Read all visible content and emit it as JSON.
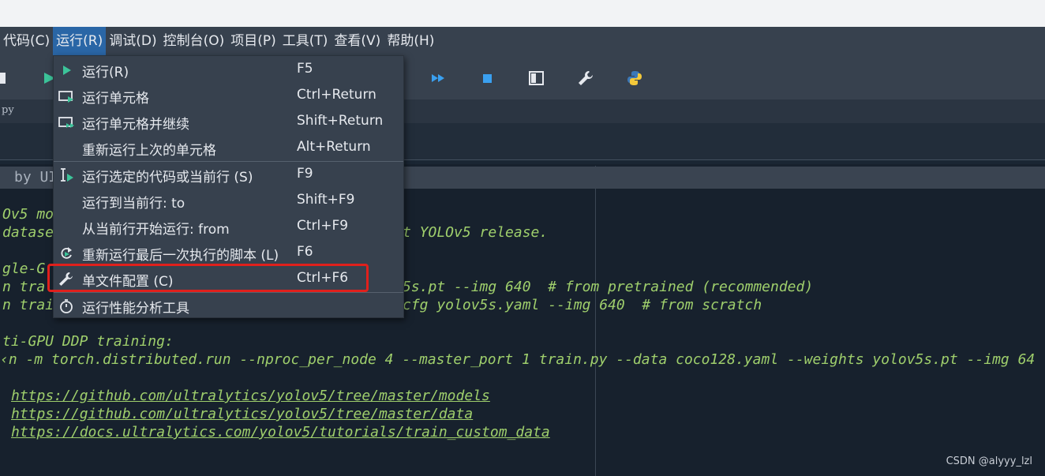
{
  "menubar": {
    "items": [
      "代码(C)",
      "运行(R)",
      "调试(D)",
      "控制台(O)",
      "项目(P)",
      "工具(T)",
      "查看(V)",
      "帮助(H)"
    ],
    "active_index": 1
  },
  "tab": {
    "text": "py"
  },
  "editor_header": "by UI",
  "run_menu": {
    "items": [
      {
        "label": "运行(R)",
        "shortcut": "F5",
        "icon": "play-icon"
      },
      {
        "label": "运行单元格",
        "shortcut": "Ctrl+Return",
        "icon": "run-cell-icon"
      },
      {
        "label": "运行单元格并继续",
        "shortcut": "Shift+Return",
        "icon": "run-cell-advance-icon"
      },
      {
        "label": "重新运行上次的单元格",
        "shortcut": "Alt+Return",
        "icon": ""
      },
      {
        "label": "运行选定的代码或当前行 (S)",
        "shortcut": "F9",
        "icon": "run-selection-icon"
      },
      {
        "label": "运行到当前行: to",
        "shortcut": "Shift+F9",
        "icon": ""
      },
      {
        "label": "从当前行开始运行: from",
        "shortcut": "Ctrl+F9",
        "icon": ""
      },
      {
        "label": "重新运行最后一次执行的脚本 (L)",
        "shortcut": "F6",
        "icon": "rerun-icon"
      },
      {
        "label": "单文件配置 (C)",
        "shortcut": "Ctrl+F6",
        "icon": "wrench-icon"
      },
      {
        "label": "运行性能分析工具",
        "shortcut": "",
        "icon": "stopwatch-icon"
      }
    ]
  },
  "code_lines": [
    "Ov5 mo",
    "datase",
    "t YOLOv5 release.",
    "gle-G",
    "n tra",
    "5s.pt --img 640  # from pretrained (recommended)",
    "n trai",
    "cfg yolov5s.yaml --img 640  # from scratch",
    "ti-GPU DDP training:",
    "‹n -m torch.distributed.run --nproc_per_node 4 --master_port 1 train.py --data coco128.yaml --weights yolov5s.pt --img 64"
  ],
  "links": [
    "https://github.com/ultralytics/yolov5/tree/master/models",
    "https://github.com/ultralytics/yolov5/tree/master/data",
    "https://docs.ultralytics.com/yolov5/tutorials/train_custom_data"
  ],
  "watermark": "CSDN @alyyy_lzl",
  "colors": {
    "accent": "#2a66a6",
    "highlight_border": "#e0201c",
    "code": "#9fcf6c"
  }
}
